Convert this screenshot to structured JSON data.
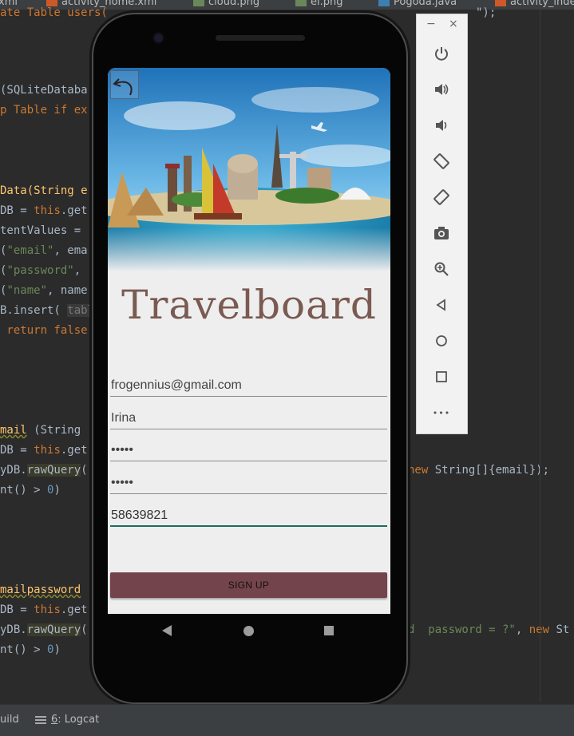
{
  "editor": {
    "tabs": [
      {
        "label": "xml"
      },
      {
        "label": "activity_home.xml"
      },
      {
        "label": "cloud.png"
      },
      {
        "label": "el.png"
      },
      {
        "label": "Pogoda.java"
      },
      {
        "label": "activity_inde"
      }
    ],
    "top_partial": "ate Table users(",
    "top_right": "\");",
    "lines": {
      "l1": "(SQLiteDataba",
      "l2_kw": "p Table if ex",
      "l3": "Data(String e",
      "l4a": "DB = ",
      "l4b": "this",
      "l4c": ".get",
      "l5": "tentValues = ",
      "l6a": "(",
      "l6b": "\"email\"",
      "l6c": ", ema",
      "l7a": "(",
      "l7b": "\"password\"",
      "l7c": ",",
      "l8a": "(",
      "l8b": "\"name\"",
      "l8c": ", name",
      "l9a": "B.insert( ",
      "l9b": "tabl",
      "l10": " return false",
      "l11a": "mail",
      "l11b": " (String",
      "l12a": "DB = ",
      "l12b": "this",
      "l12c": ".get",
      "l13a": "yDB.",
      "l13b": "rawQuery",
      "l13c": "(",
      "l13r1": "new",
      "l13r2": " String[]{email});",
      "l14a": "nt() > ",
      "l14b": "0",
      "l14c": ")",
      "l15": "mailpassword",
      "l16a": "DB = ",
      "l16b": "this",
      "l16c": ".get",
      "l17a": "yDB.",
      "l17b": "rawQuery",
      "l17c": "(",
      "l17r1": "d  password = ?\"",
      "l17r2": ", ",
      "l17r3": "new",
      "l17r4": " St",
      "l18a": "nt() > ",
      "l18b": "0",
      "l18c": ")"
    }
  },
  "bottom_bar": {
    "build_label": "uild",
    "logcat_num": "6",
    "logcat_label": ": Logcat"
  },
  "app": {
    "title": "Travelboard",
    "fields": {
      "email": "frogennius@gmail.com",
      "name": "Irina",
      "password": "•••••",
      "confirm_password": "•••••",
      "phone": "58639821"
    },
    "signup_label": "SIGN UP"
  },
  "emulator_panel": {
    "minimize": "−",
    "close": "×",
    "more": "•••"
  }
}
